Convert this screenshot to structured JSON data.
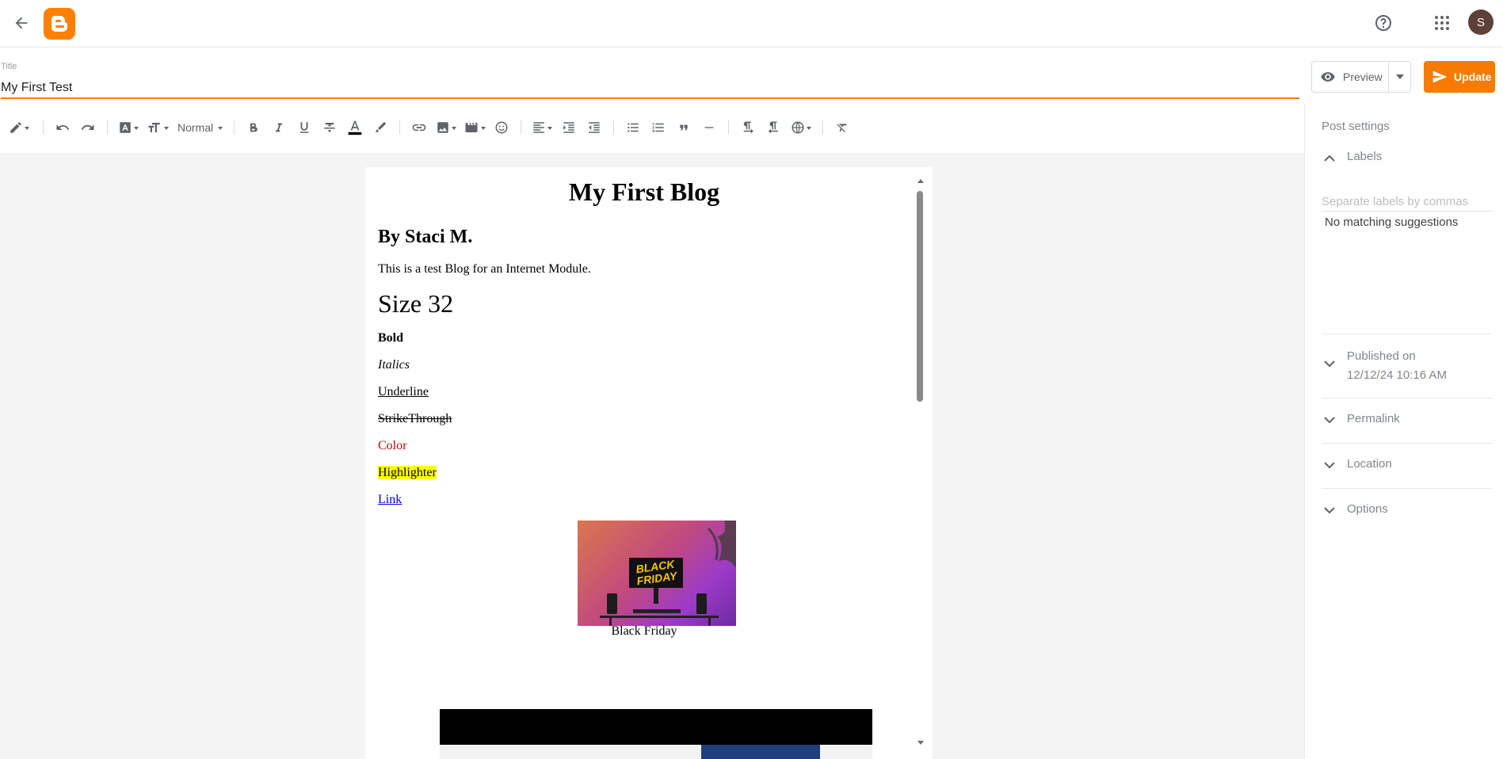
{
  "header": {
    "back_icon": "arrow-back-icon",
    "logo_icon": "blogger-logo-icon",
    "help_icon": "help-circle-icon",
    "apps_icon": "apps-grid-icon",
    "avatar_initial": "S",
    "brand_color": "#ff8000"
  },
  "post": {
    "title_label": "Title",
    "title_value": "My First Test"
  },
  "actions": {
    "preview_label": "Preview",
    "update_label": "Update",
    "accent_color": "#f57c00"
  },
  "toolbar": {
    "paragraph_style": "Normal",
    "tools": [
      "pencil-mode-icon",
      "undo-icon",
      "redo-icon",
      "font-icon",
      "font-size-icon",
      "bold-icon",
      "italic-icon",
      "underline-icon",
      "strikethrough-icon",
      "text-color-icon",
      "highlight-icon",
      "link-icon",
      "image-icon",
      "video-icon",
      "emoji-icon",
      "align-icon",
      "indent-icon",
      "outdent-icon",
      "bulleted-list-icon",
      "numbered-list-icon",
      "quote-icon",
      "horizontal-rule-icon",
      "ltr-icon",
      "rtl-icon",
      "language-icon",
      "clear-formatting-icon"
    ]
  },
  "document": {
    "heading": "My First Blog",
    "byline": "By Staci M.",
    "intro": "This is a test Blog for an Internet Module.",
    "size_sample": "Size 32",
    "bold_sample": "Bold",
    "italic_sample": "Italics",
    "underline_sample": "Underline",
    "strike_sample": "StrikeThrough",
    "color_sample": "Color",
    "highlight_sample": "Highlighter",
    "link_sample": "Link",
    "image_caption": "Black Friday",
    "image_sign": [
      "BLACK",
      "FRIDAY"
    ],
    "color_sample_color": "#cc0000",
    "highlight_color": "#ffff00",
    "link_color": "#0000ee"
  },
  "settings": {
    "title": "Post settings",
    "labels_heading": "Labels",
    "labels_placeholder": "Separate labels by commas",
    "labels_empty": "No matching suggestions",
    "published_label": "Published on",
    "published_value": "12/12/24 10:16 AM",
    "permalink_label": "Permalink",
    "location_label": "Location",
    "options_label": "Options"
  }
}
